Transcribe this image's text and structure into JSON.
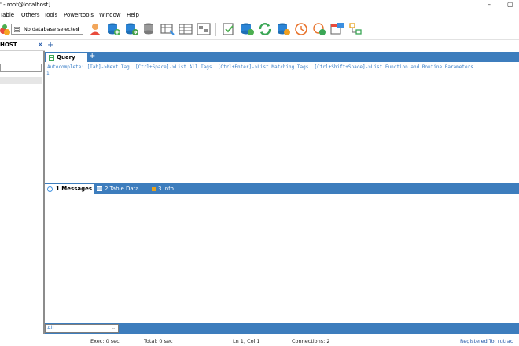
{
  "window": {
    "title": "' - root@localhost]",
    "min_glyph": "–",
    "restore_glyph": "▢"
  },
  "menu": [
    {
      "label": "Table"
    },
    {
      "label": "Others"
    },
    {
      "label": "Tools"
    },
    {
      "label": "Powertools"
    },
    {
      "label": "Window"
    },
    {
      "label": "Help"
    }
  ],
  "toolbar": {
    "database_select": {
      "value": "No database selected",
      "icon": "database-icon"
    },
    "icons": [
      "new-connection-icon",
      "user-manager-icon",
      "add-database-icon",
      "copy-database-icon",
      "create-table-icon",
      "alter-table-icon",
      "table-grid-icon",
      "schema-icon",
      "import-icon",
      "backup-database-icon",
      "sync-icon",
      "restore-database-icon",
      "scheduler-icon",
      "run-job-icon",
      "query-builder-icon",
      "schema-designer-icon"
    ]
  },
  "object_browser": {
    "tab_label": "HOST",
    "close_glyph": "×",
    "add_glyph": "+"
  },
  "query": {
    "tab_label": "Query",
    "add_glyph": "+",
    "autocomplete_hint": "Autocomplete: [Tab]->Next Tag. [Ctrl+Space]->List All Tags. [Ctrl+Enter]->List Matching Tags. [Ctrl+Shift+Space]->List Function and Routine Parameters.",
    "line_number": "1"
  },
  "results": {
    "tabs": [
      {
        "label": "1 Messages"
      },
      {
        "label": "2 Table Data"
      },
      {
        "label": "3 Info"
      }
    ]
  },
  "bottom": {
    "result_select": "All",
    "dropdown_glyph": "⌄"
  },
  "status": {
    "exec": "Exec: 0 sec",
    "total": "Total: 0 sec",
    "position": "Ln 1, Col 1",
    "connections": "Connections: 2",
    "registered": "Registered To: rutrac"
  },
  "colors": {
    "accent_blue": "#3d7dbd",
    "text_blue": "#3a7fc8",
    "info_orange": "#e8a21d"
  }
}
